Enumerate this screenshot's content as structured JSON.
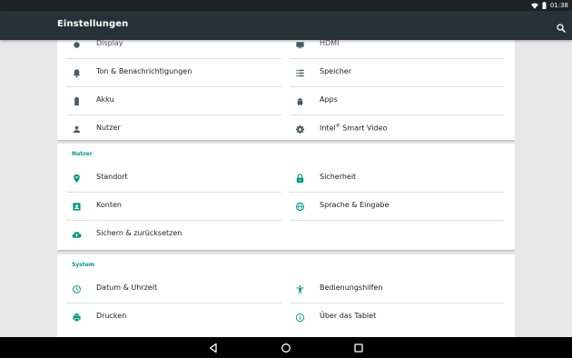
{
  "status_bar": {
    "time": "01:38"
  },
  "toolbar": {
    "title": "Einstellungen"
  },
  "top_partial": {
    "left": "Display",
    "right": "HDMI"
  },
  "device_section": {
    "rows": [
      {
        "left": "Ton & Benachrichtigungen",
        "right": "Speicher"
      },
      {
        "left": "Akku",
        "right": "Apps"
      },
      {
        "left": "Nutzer",
        "right_prefix": "Intel",
        "right_sup": "®",
        "right_suffix": " Smart Video"
      }
    ]
  },
  "user_section": {
    "header": "Nutzer",
    "rows": [
      {
        "left": "Standort",
        "right": "Sicherheit"
      },
      {
        "left": "Konten",
        "right": "Sprache & Eingabe"
      },
      {
        "left": "Sichern & zurücksetzen"
      }
    ]
  },
  "system_section": {
    "header": "System",
    "rows": [
      {
        "left": "Datum & Uhrzeit",
        "right": "Bedienungshilfen"
      },
      {
        "left": "Drucken",
        "right": "Über das Tablet"
      }
    ]
  },
  "colors": {
    "accent": "#009688",
    "toolbar": "#263238",
    "icon": "#455a64"
  }
}
